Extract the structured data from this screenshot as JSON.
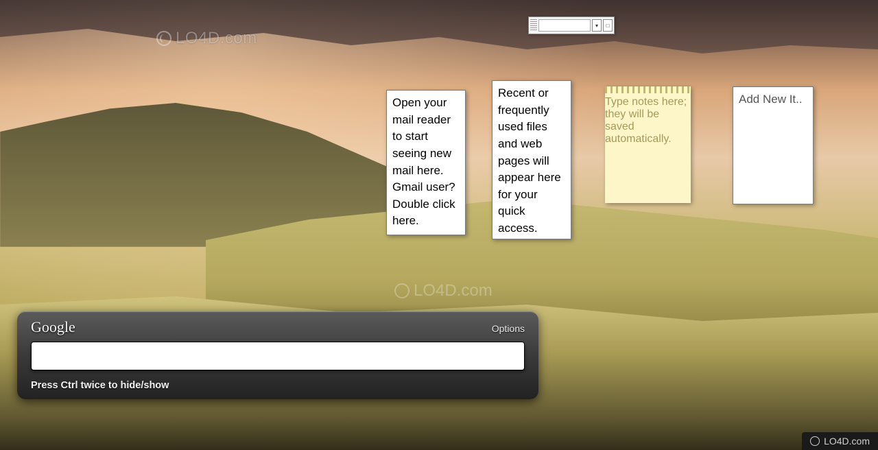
{
  "watermark": {
    "text": "LO4D.com"
  },
  "toolbar_gadget": {
    "dropdown_glyph": "▾",
    "box_glyph": "□"
  },
  "gadgets": {
    "mail": {
      "text": "Open your mail reader to start seeing new mail here. Gmail user? Double click here."
    },
    "recent": {
      "text": "Recent or frequently used files and web pages will appear here for your quick access."
    },
    "notes": {
      "placeholder": "Type notes here; they will be saved automatically."
    },
    "list": {
      "placeholder": "Add New It.."
    }
  },
  "search": {
    "logo": "Google",
    "options_label": "Options",
    "input_value": "",
    "hint": "Press Ctrl twice to hide/show"
  }
}
